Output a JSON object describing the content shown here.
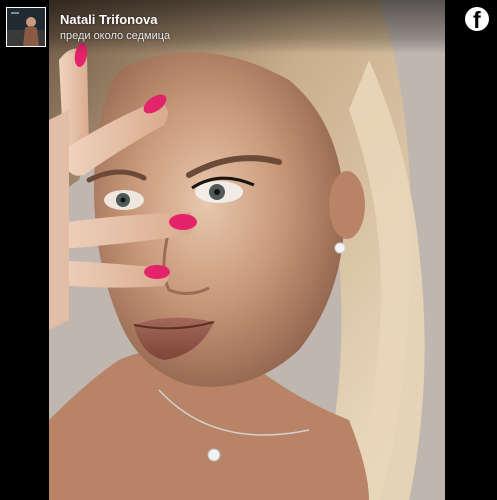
{
  "post": {
    "author_name": "Natali Trifonova",
    "timestamp": "преди около седмица",
    "platform_icon": "facebook-logo-icon",
    "avatar_icon": "profile-avatar"
  },
  "colors": {
    "background": "#000000",
    "header_text": "#ffffff",
    "nail_polish": "#e4246a",
    "hair": "#d9c3a3"
  }
}
